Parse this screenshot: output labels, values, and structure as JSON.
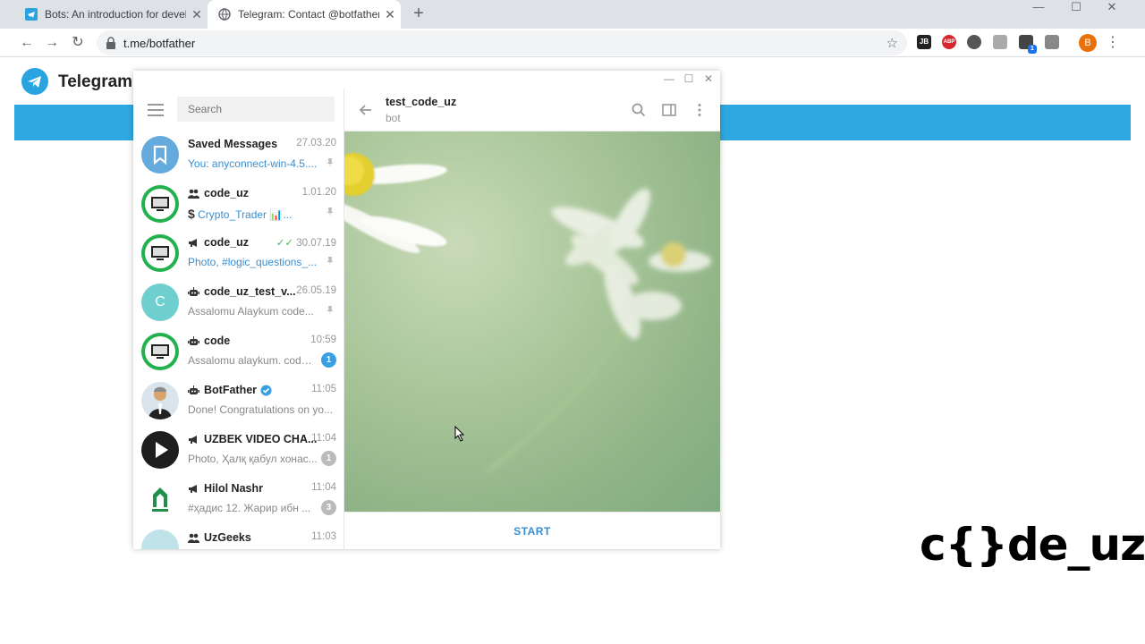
{
  "browser": {
    "tabs": [
      {
        "title": "Bots: An introduction for develop",
        "icon": "telegram-icon",
        "active": false
      },
      {
        "title": "Telegram: Contact @botfather",
        "icon": "globe-icon",
        "active": true
      }
    ],
    "new_tab": "+",
    "url": "t.me/botfather",
    "profile_initial": "B",
    "extensions": [
      "JB",
      "ABP"
    ],
    "extension_badge": "1"
  },
  "page": {
    "header_title": "Telegram",
    "brand": "c{}de_uz"
  },
  "sidebar": {
    "search_placeholder": "Search",
    "chats": [
      {
        "name": "Saved Messages",
        "date": "27.03.20",
        "preview_prefix": "",
        "preview": "You: anyconnect-win-4.5....",
        "preview_blue": true,
        "pinned": true,
        "type": "saved"
      },
      {
        "name": "code_uz",
        "date": "1.01.20",
        "preview_prefix": "$",
        "preview": "Crypto_Trader 📊...",
        "preview_blue": true,
        "pinned": true,
        "type": "group"
      },
      {
        "name": "code_uz",
        "date": "30.07.19",
        "preview_prefix": "",
        "preview": "Photo, #logic_questions_...",
        "preview_blue_word": "Photo,",
        "pinned": true,
        "read": true,
        "type": "channel"
      },
      {
        "name": "code_uz_test_v...",
        "date": "26.05.19",
        "avatar_letter": "C",
        "preview": "Assalomu Alaykum  code...",
        "pinned": true,
        "type": "bot"
      },
      {
        "name": "code",
        "date": "10:59",
        "preview": "Assalomu alaykum. code ...",
        "badge": "1",
        "type": "bot"
      },
      {
        "name": "BotFather",
        "date": "11:05",
        "preview": "Done! Congratulations on yo...",
        "verified": true,
        "type": "bot"
      },
      {
        "name": "UZBEK VIDEO CHA...",
        "date": "11:04",
        "preview": "Photo, Ҳалқ қабул хонас...",
        "preview_blue_word": "Photo,",
        "badge": "1",
        "type": "channel"
      },
      {
        "name": "Hilol Nashr",
        "date": "11:04",
        "preview": "#ҳадис  12. Жарир ибн ...",
        "badge": "3",
        "type": "channel"
      },
      {
        "name": "UzGeeks",
        "date": "11:03",
        "preview": "",
        "type": "group"
      }
    ]
  },
  "chat": {
    "peer_name": "test_code_uz",
    "peer_status": "bot",
    "start_label": "START"
  },
  "colors": {
    "telegram_blue": "#2fa7e0",
    "link_blue": "#3a8ed0",
    "unread_badge": "#3a9ee3"
  }
}
